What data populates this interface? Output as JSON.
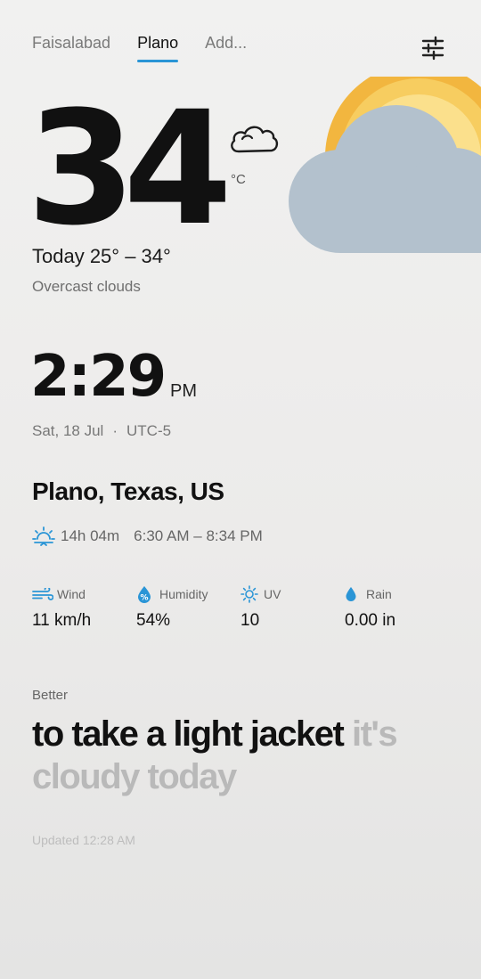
{
  "tabs": [
    {
      "label": "Faisalabad",
      "active": false
    },
    {
      "label": "Plano",
      "active": true
    },
    {
      "label": "Add...",
      "active": false
    }
  ],
  "settings_icon": "sliders-icon",
  "illustration": {
    "sun_color": "#f2b63f",
    "cloud_color": "#b3c1cd"
  },
  "weather": {
    "temperature": "34",
    "unit": "°C",
    "condition_icon": "cloud-icon",
    "range": "Today 25° – 34°",
    "condition": "Overcast clouds"
  },
  "time": {
    "clock": "2:29",
    "ampm": "PM",
    "date": "Sat, 18 Jul",
    "separator": "·",
    "timezone": "UTC-5"
  },
  "location": "Plano, Texas, US",
  "sun": {
    "icon": "sunrise-icon",
    "day_length": "14h 04m",
    "range": "6:30 AM – 8:34 PM"
  },
  "stats": {
    "wind": {
      "label": "Wind",
      "value": "11 km/h",
      "icon": "wind-icon"
    },
    "humidity": {
      "label": "Humidity",
      "value": "54%",
      "icon": "humidity-icon"
    },
    "uv": {
      "label": "UV",
      "value": "10",
      "icon": "sun-icon"
    },
    "rain": {
      "label": "Rain",
      "value": "0.00 in",
      "icon": "raindrop-icon"
    }
  },
  "advice": {
    "label": "Better",
    "strong": "to take a light jacket",
    "muted": "it's cloudy today"
  },
  "updated": "Updated 12:28 AM",
  "colors": {
    "accent": "#2a95d6",
    "text": "#111111",
    "muted": "#b9b9b9"
  }
}
